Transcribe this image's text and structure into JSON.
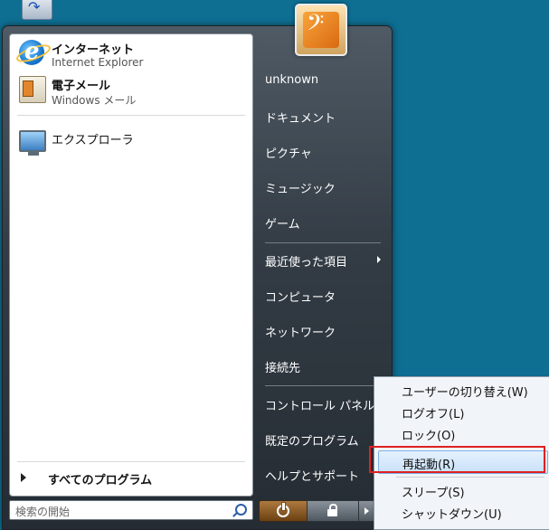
{
  "start_menu": {
    "pinned": [
      {
        "title": "インターネット",
        "subtitle": "Internet Explorer",
        "icon": "internet-explorer-icon"
      },
      {
        "title": "電子メール",
        "subtitle": "Windows メール",
        "icon": "windows-mail-icon"
      }
    ],
    "recent": [
      {
        "title": "エクスプローラ",
        "icon": "explorer-monitor-icon"
      }
    ],
    "all_programs": "すべてのプログラム",
    "search": {
      "placeholder": "検索の開始"
    },
    "right_pane": {
      "user": "unknown",
      "group1": [
        "ドキュメント",
        "ピクチャ",
        "ミュージック",
        "ゲーム"
      ],
      "group2": [
        "最近使った項目",
        "コンピュータ",
        "ネットワーク",
        "接続先"
      ],
      "group3": [
        "コントロール パネル",
        "既定のプログラム",
        "ヘルプとサポート"
      ]
    }
  },
  "power_menu": {
    "items": [
      {
        "label": "ユーザーの切り替え(W)"
      },
      {
        "label": "ログオフ(L)"
      },
      {
        "label": "ロック(O)"
      },
      {
        "label": "再起動(R)",
        "selected": true
      },
      {
        "label": "スリープ(S)"
      },
      {
        "label": "シャットダウン(U)"
      }
    ]
  },
  "colors": {
    "desktop": "#0e6f93",
    "highlight_border": "#e0201f",
    "power_button": "#8b5a24"
  }
}
